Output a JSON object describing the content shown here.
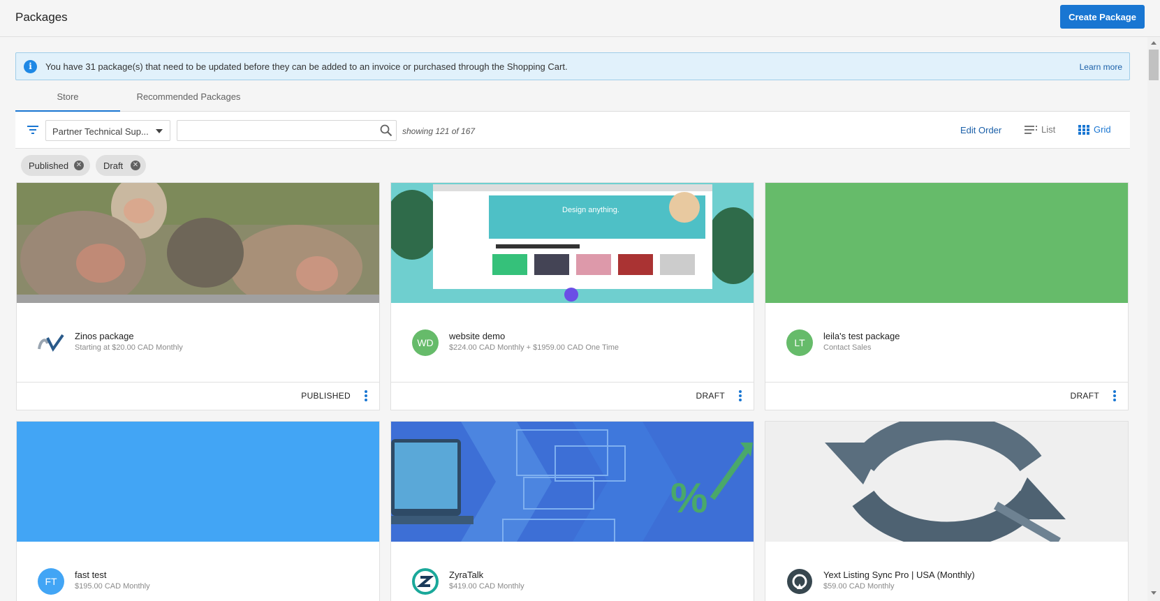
{
  "header": {
    "title": "Packages",
    "create_label": "Create Package"
  },
  "banner": {
    "info_icon": "i",
    "text": "You have 31 package(s) that need to be updated before they can be added to an invoice or purchased through the Shopping Cart.",
    "link": "Learn more"
  },
  "tabs": [
    {
      "label": "Store",
      "active": true
    },
    {
      "label": "Recommended Packages",
      "active": false
    }
  ],
  "toolbar": {
    "filter_select": "Partner Technical Sup...",
    "search_placeholder": "",
    "showing": "showing 121 of 167",
    "edit_order": "Edit Order",
    "list_label": "List",
    "grid_label": "Grid"
  },
  "chips": [
    {
      "label": "Published"
    },
    {
      "label": "Draft"
    }
  ],
  "cards": [
    {
      "name": "Zinos package",
      "price": "Starting at $20.00 CAD Monthly",
      "status": "PUBLISHED",
      "avatar": "",
      "avatar_color": "#ffffff",
      "image": "monkeys-photo"
    },
    {
      "name": "website demo",
      "price": "$224.00 CAD Monthly + $1959.00 CAD One Time",
      "status": "DRAFT",
      "avatar": "WD",
      "avatar_color": "#66bb6a",
      "image": "design-anything-screenshot"
    },
    {
      "name": "leila's test package",
      "price": "Contact Sales",
      "status": "DRAFT",
      "avatar": "LT",
      "avatar_color": "#66bb6a",
      "image": "solid-green"
    },
    {
      "name": "fast test",
      "price": "$195.00 CAD Monthly",
      "status": "",
      "avatar": "FT",
      "avatar_color": "#42a5f5",
      "image": "solid-blue"
    },
    {
      "name": "ZyraTalk",
      "price": "$419.00 CAD Monthly",
      "status": "",
      "avatar": "",
      "avatar_color": "#ffffff",
      "image": "chat-laptop-graphic"
    },
    {
      "name": "Yext Listing Sync Pro | USA (Monthly)",
      "price": "$59.00 CAD Monthly",
      "status": "",
      "avatar": "",
      "avatar_color": "#ffffff",
      "image": "sync-arrows-graphic"
    }
  ],
  "colors": {
    "accent": "#1976d2",
    "green": "#66bb6a",
    "blue": "#42a5f5",
    "banner_bg": "#e1f1fb"
  }
}
